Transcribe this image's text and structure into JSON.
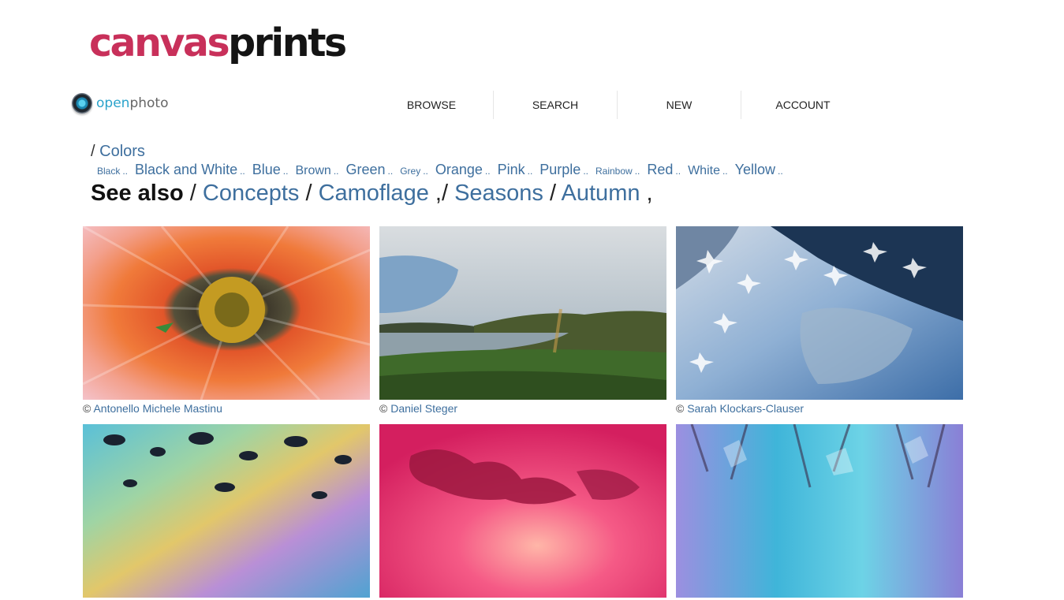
{
  "logo": {
    "part1": "canvas",
    "part2": "prints"
  },
  "openphoto": {
    "part1": "open",
    "part2": "photo"
  },
  "nav": [
    "BROWSE",
    "SEARCH",
    "NEW",
    "ACCOUNT"
  ],
  "breadcrumb": {
    "separator": "/",
    "current": "Colors"
  },
  "colors": [
    {
      "label": "Black",
      "size": "small"
    },
    {
      "label": "Black and White",
      "size": "large"
    },
    {
      "label": "Blue",
      "size": "large"
    },
    {
      "label": "Brown",
      "size": "medium"
    },
    {
      "label": "Green",
      "size": "large"
    },
    {
      "label": "Grey",
      "size": "small"
    },
    {
      "label": "Orange",
      "size": "large"
    },
    {
      "label": "Pink",
      "size": "large"
    },
    {
      "label": "Purple",
      "size": "large"
    },
    {
      "label": "Rainbow",
      "size": "small"
    },
    {
      "label": "Red",
      "size": "large"
    },
    {
      "label": "White",
      "size": "medium"
    },
    {
      "label": "Yellow",
      "size": "large"
    }
  ],
  "color_dots": "..",
  "see_also": {
    "label": "See also",
    "slash": "/",
    "comma": ",",
    "links": [
      "Concepts",
      "Camoflage",
      "Seasons",
      "Autumn"
    ]
  },
  "photos": [
    {
      "name": "flower-photo",
      "copyright": "©",
      "author": "Antonello Michele Mastinu"
    },
    {
      "name": "rainbow-lake-photo",
      "copyright": "©",
      "author": "Daniel Steger"
    },
    {
      "name": "frost-crystals-photo",
      "copyright": "©",
      "author": "Sarah Klockars-Clauser"
    },
    {
      "name": "oil-slick-photo",
      "copyright": "",
      "author": ""
    },
    {
      "name": "pink-sunset-photo",
      "copyright": "",
      "author": ""
    },
    {
      "name": "crystal-abstract-photo",
      "copyright": "",
      "author": ""
    }
  ],
  "theme": {
    "link_color": "#3e6f9e",
    "brand_pink": "#c8305a",
    "brand_dark": "#141414"
  }
}
